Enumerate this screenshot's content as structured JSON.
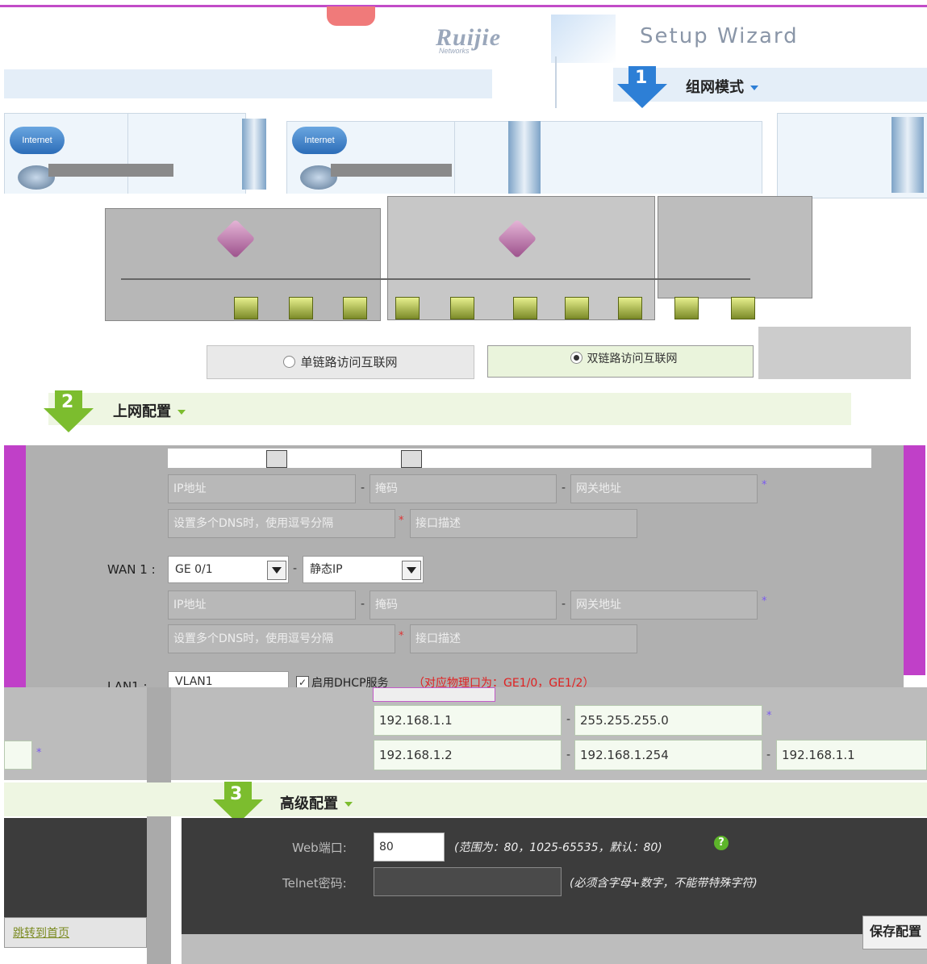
{
  "header": {
    "brand": "Ruijie",
    "brand_sub": "Networks",
    "wizard_title": "Setup Wizard"
  },
  "steps": {
    "step1": {
      "number": "1",
      "title": "组网模式"
    },
    "step2": {
      "number": "2",
      "title": "上网配置"
    },
    "step3": {
      "number": "3",
      "title": "高级配置"
    }
  },
  "topology": {
    "internet_label_1": "Internet",
    "internet_label_2": "Internet",
    "options": [
      {
        "label": "单链路访问互联网",
        "selected": false
      },
      {
        "label": "双链路访问互联网",
        "selected": true
      }
    ]
  },
  "wan": {
    "wan1_label": "WAN 1 :",
    "wan1_port": "GE 0/1",
    "wan1_mode": "静态IP",
    "ip_placeholder": "IP地址",
    "mask_placeholder": "掩码",
    "gateway_placeholder": "网关地址",
    "dns_placeholder": "设置多个DNS时，使用逗号分隔",
    "desc_placeholder": "接口描述"
  },
  "lan": {
    "label": "LAN1 :",
    "vlan": "VLAN1",
    "dhcp_label": "启用DHCP服务",
    "dhcp_note": "（对应物理口为：GE1/0，GE1/2）",
    "ip": "192.168.1.1",
    "mask": "255.255.255.0",
    "pool_start": "192.168.1.2",
    "pool_end": "192.168.1.254",
    "dns": "192.168.1.1"
  },
  "advanced": {
    "web_port_label": "Web端口:",
    "web_port_value": "80",
    "web_port_hint": "(范围为：80，1025-65535，默认：80)",
    "telnet_label": "Telnet密码:",
    "telnet_hint": "(必须含字母+数字，不能带特殊字符)"
  },
  "footer": {
    "skip_link": "跳转到首页",
    "save_button": "保存配置"
  },
  "colors": {
    "accent": "#c040c8",
    "step_arrow": "#2d7fd6",
    "step2_arrow": "#7cbd2e"
  }
}
